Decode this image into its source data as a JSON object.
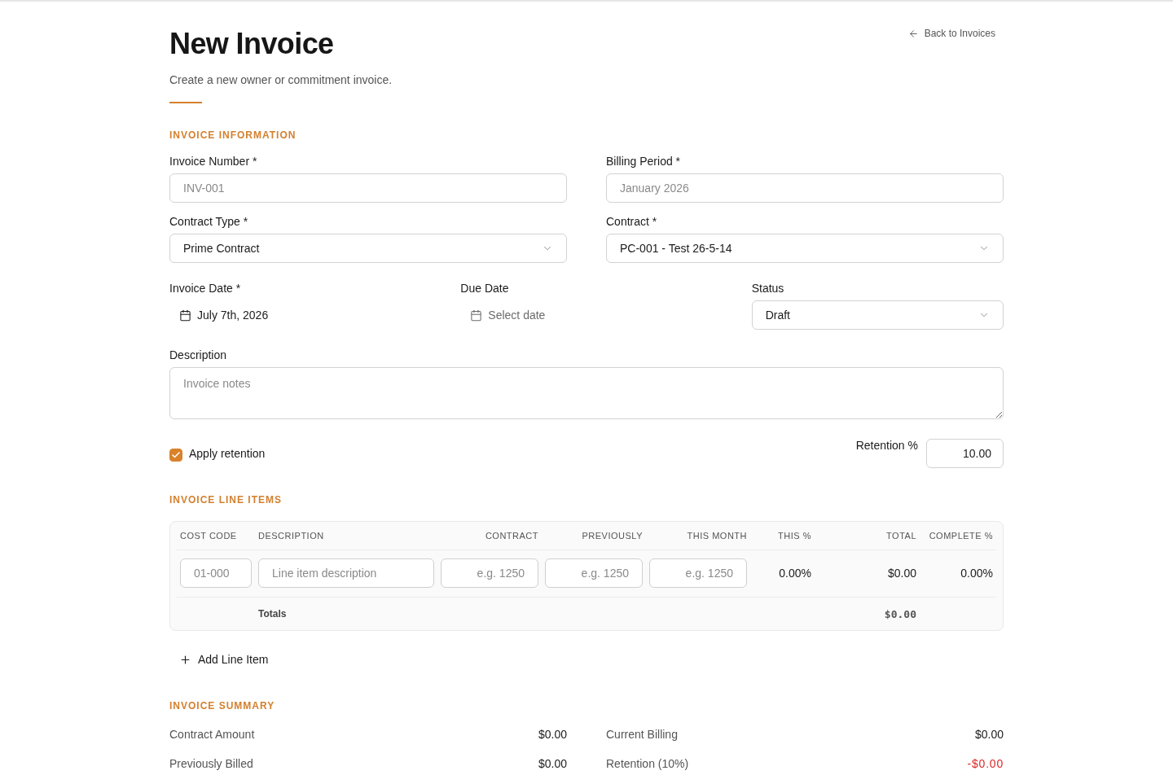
{
  "header": {
    "title": "New Invoice",
    "subtitle": "Create a new owner or commitment invoice.",
    "back_link": "Back to Invoices"
  },
  "invoice_information": {
    "heading": "INVOICE INFORMATION",
    "field_rows": [
      [
        {
          "kind": "text",
          "label": "Invoice Number *",
          "placeholder": "INV-001"
        },
        {
          "kind": "text",
          "label": "Billing Period *",
          "placeholder": "January 2026"
        }
      ],
      [
        {
          "kind": "select",
          "label": "Contract Type *",
          "value": "Prime Contract"
        },
        {
          "kind": "select",
          "label": "Contract *",
          "value": "PC-001 - Test 26-5-14"
        }
      ],
      [
        {
          "kind": "date",
          "label": "Invoice Date *",
          "value": "July 7th, 2026"
        },
        {
          "kind": "date",
          "label": "Due Date",
          "placeholder": "Select date"
        },
        {
          "kind": "select",
          "label": "Status",
          "value": "Draft"
        }
      ],
      [
        {
          "kind": "textarea",
          "label": "Description",
          "placeholder": "Invoice notes"
        }
      ]
    ],
    "retention": {
      "apply_label": "Apply retention",
      "checked": true,
      "percent_label": "Retention %",
      "percent_value": "10.00"
    }
  },
  "line_items": {
    "heading": "INVOICE LINE ITEMS",
    "columns": [
      "COST CODE",
      "DESCRIPTION",
      "CONTRACT",
      "PREVIOUSLY",
      "THIS MONTH",
      "THIS %",
      "TOTAL",
      "COMPLETE %"
    ],
    "rows": [
      {
        "cells": [
          {
            "kind": "input",
            "placeholder": "01-000"
          },
          {
            "kind": "input",
            "placeholder": "Line item description"
          },
          {
            "kind": "input",
            "placeholder": "e.g. 1250"
          },
          {
            "kind": "input",
            "placeholder": "e.g. 1250"
          },
          {
            "kind": "input",
            "placeholder": "e.g. 1250"
          },
          {
            "kind": "text",
            "value": "0.00%"
          },
          {
            "kind": "text",
            "value": "$0.00"
          },
          {
            "kind": "text",
            "value": "0.00%"
          }
        ]
      }
    ],
    "totals": {
      "label": "Totals",
      "total": "$0.00"
    },
    "add_button": "Add Line Item"
  },
  "summary": {
    "heading": "INVOICE SUMMARY",
    "items": [
      {
        "label": "Contract Amount",
        "value": "$0.00",
        "negative": false
      },
      {
        "label": "Current Billing",
        "value": "$0.00",
        "negative": false
      },
      {
        "label": "Previously Billed",
        "value": "$0.00",
        "negative": false
      },
      {
        "label": "Retention (10%)",
        "value": "-$0.00",
        "negative": true
      }
    ]
  }
}
